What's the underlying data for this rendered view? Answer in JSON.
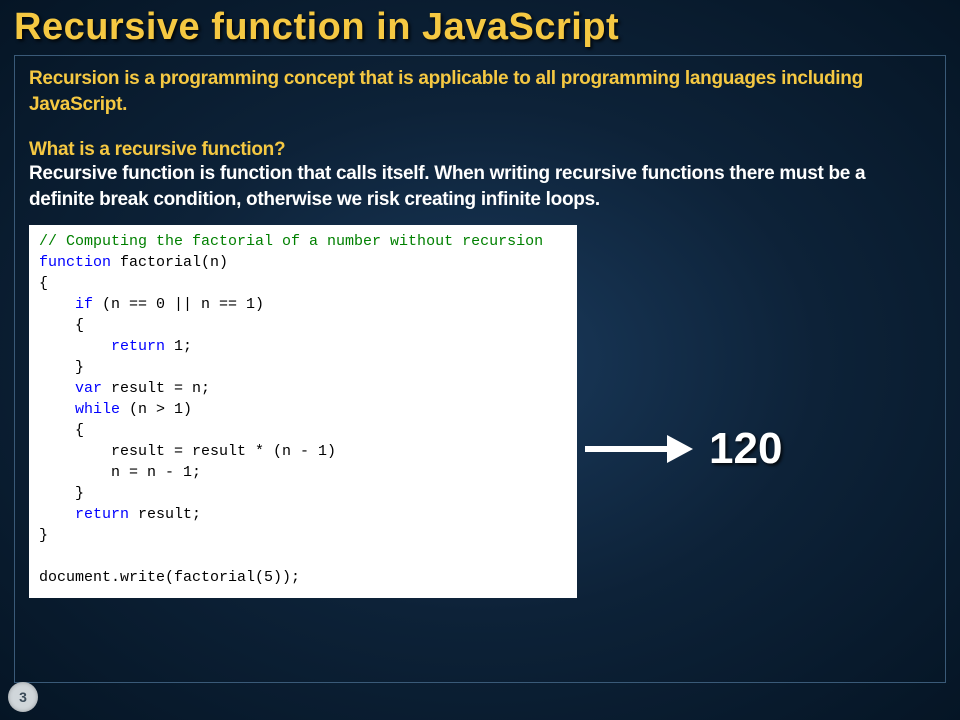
{
  "slide": {
    "title": "Recursive function in JavaScript",
    "intro": "Recursion is a programming concept that is applicable to all programming languages including JavaScript.",
    "question": "What is a recursive function?",
    "answer": "Recursive function is function that calls itself. When writing recursive functions there must be a definite break condition, otherwise we risk creating infinite loops.",
    "result": "120",
    "page": "3"
  },
  "code": {
    "comment": "// Computing the factorial of a number without recursion",
    "l2a": "function",
    "l2b": " factorial(n)",
    "l3": "{",
    "l4a": "    if",
    "l4b": " (n == 0 || n == 1)",
    "l5": "    {",
    "l6a": "        return",
    "l6b": " 1;",
    "l7": "    }",
    "l8a": "    var",
    "l8b": " result = n;",
    "l9a": "    while",
    "l9b": " (n > 1)",
    "l10": "    {",
    "l11": "        result = result * (n - 1)",
    "l12": "        n = n - 1;",
    "l13": "    }",
    "l14a": "    return",
    "l14b": " result;",
    "l15": "}",
    "l16": "",
    "l17": "document.write(factorial(5));"
  }
}
